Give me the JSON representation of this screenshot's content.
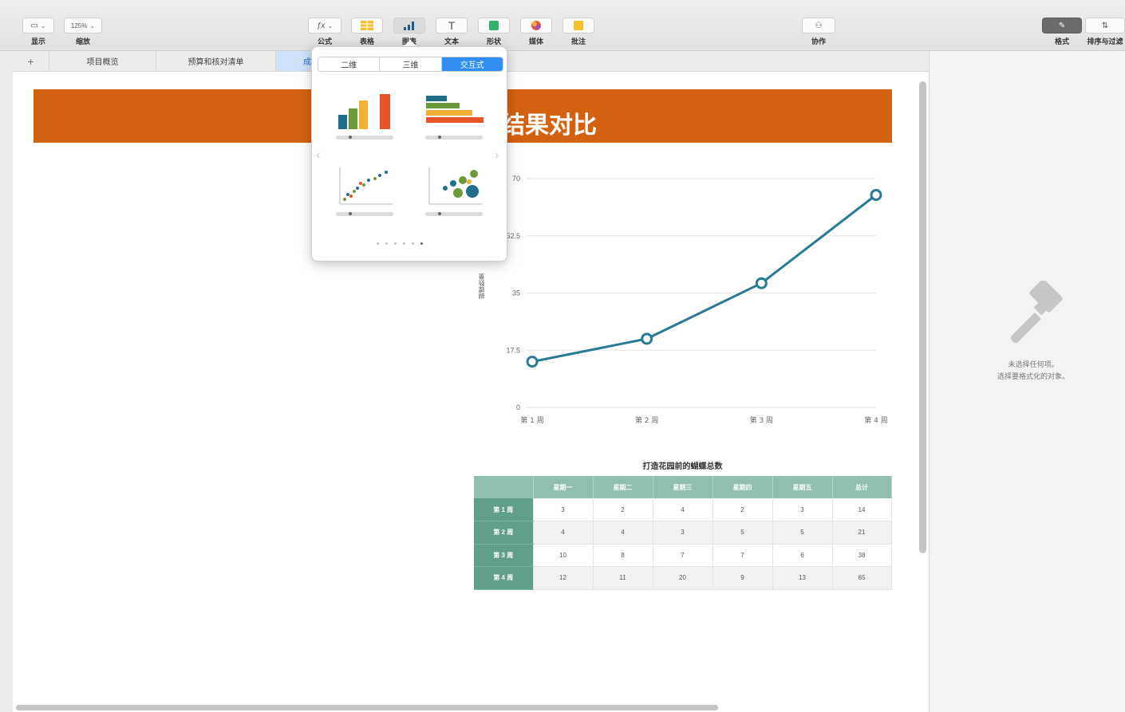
{
  "toolbar": {
    "view_label": "显示",
    "zoom_value": "125%",
    "zoom_label": "缩放",
    "formula_label": "公式",
    "table_label": "表格",
    "chart_label": "图表",
    "text_label": "文本",
    "shape_label": "形状",
    "media_label": "媒体",
    "comment_label": "批注",
    "collaborate_label": "协作",
    "format_label": "格式",
    "organize_label": "排序与过滤"
  },
  "tabs": [
    "项目概览",
    "预算和核对清单",
    "成果"
  ],
  "banner": {
    "title": "结果对比"
  },
  "chart_data": {
    "type": "line",
    "categories": [
      "第 1 周",
      "第 2 周",
      "第 3 周",
      "第 4 周"
    ],
    "series": [
      {
        "values": [
          14,
          21,
          38,
          65
        ],
        "color": "#2a7a96"
      }
    ],
    "yticks": [
      "0",
      "17.5",
      "35",
      "52.5",
      "70"
    ],
    "ylim": [
      0,
      70
    ],
    "ylabel": "蝴蝶数量",
    "grid": true
  },
  "table": {
    "title": "打造花园前的蝴蝶总数",
    "columns": [
      "",
      "星期一",
      "星期二",
      "星期三",
      "星期四",
      "星期五",
      "总计"
    ],
    "rows": [
      {
        "head": "第 1 周",
        "cells": [
          "3",
          "2",
          "4",
          "2",
          "3",
          "14"
        ]
      },
      {
        "head": "第 2 周",
        "cells": [
          "4",
          "4",
          "3",
          "5",
          "5",
          "21"
        ]
      },
      {
        "head": "第 3 周",
        "cells": [
          "10",
          "8",
          "7",
          "7",
          "6",
          "38"
        ]
      },
      {
        "head": "第 4 周",
        "cells": [
          "12",
          "11",
          "20",
          "9",
          "13",
          "65"
        ]
      }
    ]
  },
  "popover": {
    "segments": [
      "二维",
      "三维",
      "交互式"
    ],
    "active_segment": "交互式",
    "page_count": 6,
    "current_page": 6
  },
  "inspector": {
    "line1": "未选择任何项。",
    "line2": "选择要格式化的对象。"
  },
  "colors": {
    "banner": "#d4610f",
    "line": "#2a7a96",
    "table_header": "#8fbfb0",
    "row_header": "#5f9f8c",
    "accent": "#2f8ff2"
  }
}
